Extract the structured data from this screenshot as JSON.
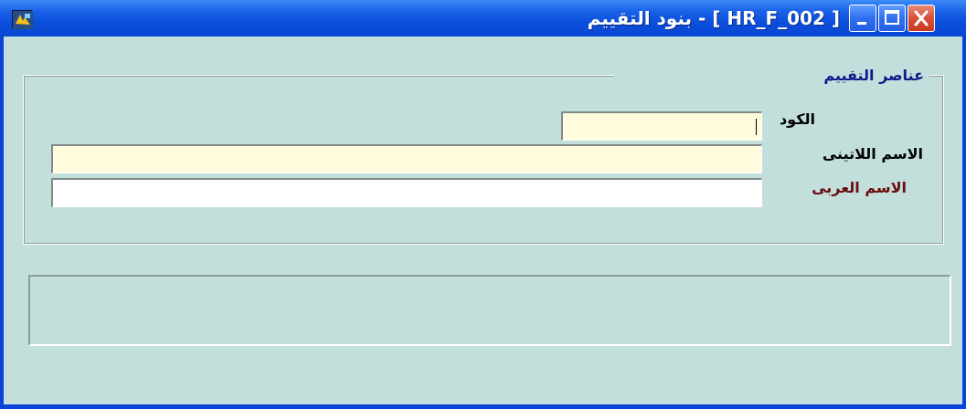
{
  "window": {
    "title": "بنود التقييم - [ HR_F_002 ]",
    "buttons": {
      "minimize_icon": "minimize-icon",
      "maximize_icon": "maximize-icon",
      "close_icon": "close-icon"
    },
    "app_icon": "form-app-icon"
  },
  "group": {
    "legend": "عناصر التقييم"
  },
  "fields": {
    "code": {
      "label": "الكود",
      "value": ""
    },
    "latin_name": {
      "label": "الاسم اللاتينى",
      "value": ""
    },
    "arabic_name": {
      "label": "الاسم العربى",
      "value": ""
    }
  },
  "colors": {
    "titlebar": "#0b4fdc",
    "client_bg": "#c3dfdc",
    "field_bg": "#fefcdc",
    "legend_text": "#0e1b8c",
    "arabic_label_text": "#6a0d0d"
  }
}
